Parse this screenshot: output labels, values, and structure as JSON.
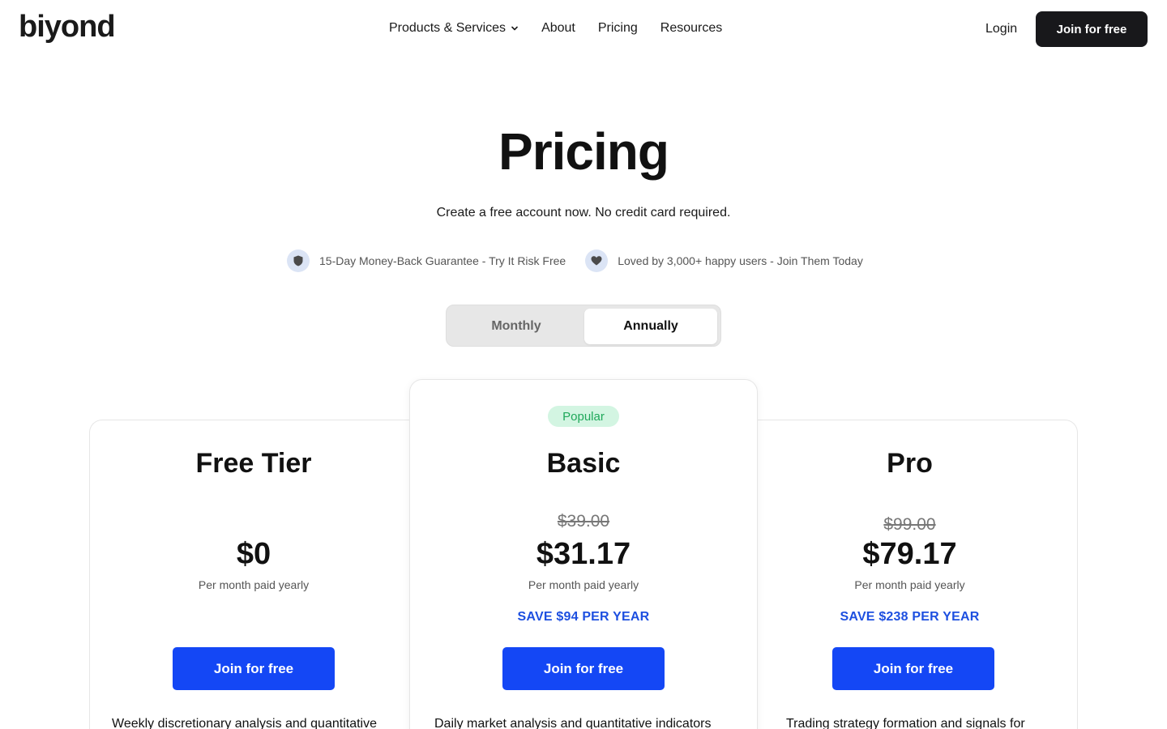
{
  "header": {
    "logo": "biyond",
    "nav": [
      {
        "label": "Products & Services",
        "has_dropdown": true
      },
      {
        "label": "About"
      },
      {
        "label": "Pricing"
      },
      {
        "label": "Resources"
      }
    ],
    "login_label": "Login",
    "join_label": "Join for free"
  },
  "hero": {
    "title": "Pricing",
    "subtitle": "Create a free account now. No credit card required.",
    "badges": [
      {
        "icon": "shield-icon",
        "text": "15-Day Money-Back Guarantee - Try It Risk Free"
      },
      {
        "icon": "heart-icon",
        "text": "Loved by 3,000+ happy users - Join Them Today"
      }
    ]
  },
  "billing_toggle": {
    "options": [
      "Monthly",
      "Annually"
    ],
    "selected": "Annually"
  },
  "plans": [
    {
      "name": "Free Tier",
      "price": "$0",
      "period": "Per month paid yearly",
      "cta": "Join for free",
      "description": "Weekly discretionary analysis and quantitative"
    },
    {
      "name": "Basic",
      "badge": "Popular",
      "old_price": "$39.00",
      "price": "$31.17",
      "period": "Per month paid yearly",
      "save": "SAVE $94 PER YEAR",
      "cta": "Join for free",
      "description": "Daily market analysis and quantitative indicators"
    },
    {
      "name": "Pro",
      "old_price": "$99.00",
      "price": "$79.17",
      "period": "Per month paid yearly",
      "save": "SAVE $238 PER YEAR",
      "cta": "Join for free",
      "description": "Trading strategy formation and signals for"
    }
  ],
  "colors": {
    "primary_blue": "#1447f5",
    "save_blue": "#1d4fe0",
    "dark_button": "#18181b",
    "popular_bg": "#d3f5e2",
    "popular_text": "#1fa85a"
  }
}
